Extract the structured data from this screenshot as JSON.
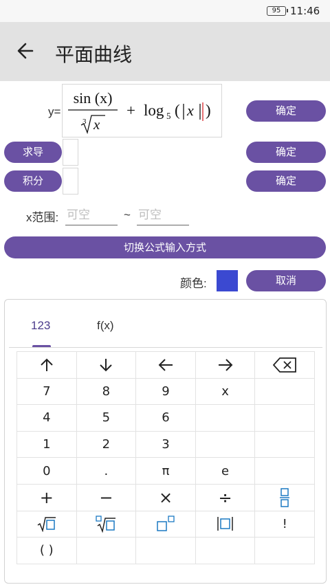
{
  "status_bar": {
    "battery": "95",
    "time": "11:46"
  },
  "app_bar": {
    "title": "平面曲线",
    "back_icon": "arrow-left-icon"
  },
  "formula": {
    "y_label": "y=",
    "frac_numerator": "sin (x)",
    "frac_denominator_index": "3",
    "frac_denominator_radicand": "x",
    "plus": "+",
    "log_label": "log",
    "log_base": "5",
    "abs_arg": "x"
  },
  "buttons": {
    "confirm_formula": "确定",
    "derivative": "求导",
    "confirm_derivative": "确定",
    "integral": "积分",
    "confirm_integral": "确定",
    "switch_input": "切换公式输入方式",
    "cancel": "取消"
  },
  "range": {
    "label": "x范围:",
    "min_placeholder": "可空",
    "separator": "~",
    "max_placeholder": "可空"
  },
  "color_picker": {
    "label": "颜色:",
    "value": "#3b49d1"
  },
  "keyboard": {
    "tabs": [
      "123",
      "f(x)"
    ],
    "active_tab": "123",
    "keys": {
      "up": "↑",
      "down": "↓",
      "left": "←",
      "right": "→",
      "backspace": "backspace-icon",
      "seven": "7",
      "eight": "8",
      "nine": "9",
      "x": "x",
      "four": "4",
      "five": "5",
      "six": "6",
      "one": "1",
      "two": "2",
      "three": "3",
      "zero": "0",
      "dot": ".",
      "pi": "π",
      "e": "e",
      "plus": "+",
      "minus": "−",
      "times": "×",
      "divide": "÷",
      "fraction": "fraction-icon",
      "sqrt": "sqrt-icon",
      "nth_root": "nth-root-icon",
      "power": "power-icon",
      "abs": "abs-icon",
      "factorial": "!",
      "parens": "( )"
    }
  },
  "colors": {
    "accent": "#6a51a3",
    "tab_active": "#4b3c8c",
    "key_icon_blue": "#1a78c2",
    "app_bar_bg": "#e2e2e2"
  }
}
